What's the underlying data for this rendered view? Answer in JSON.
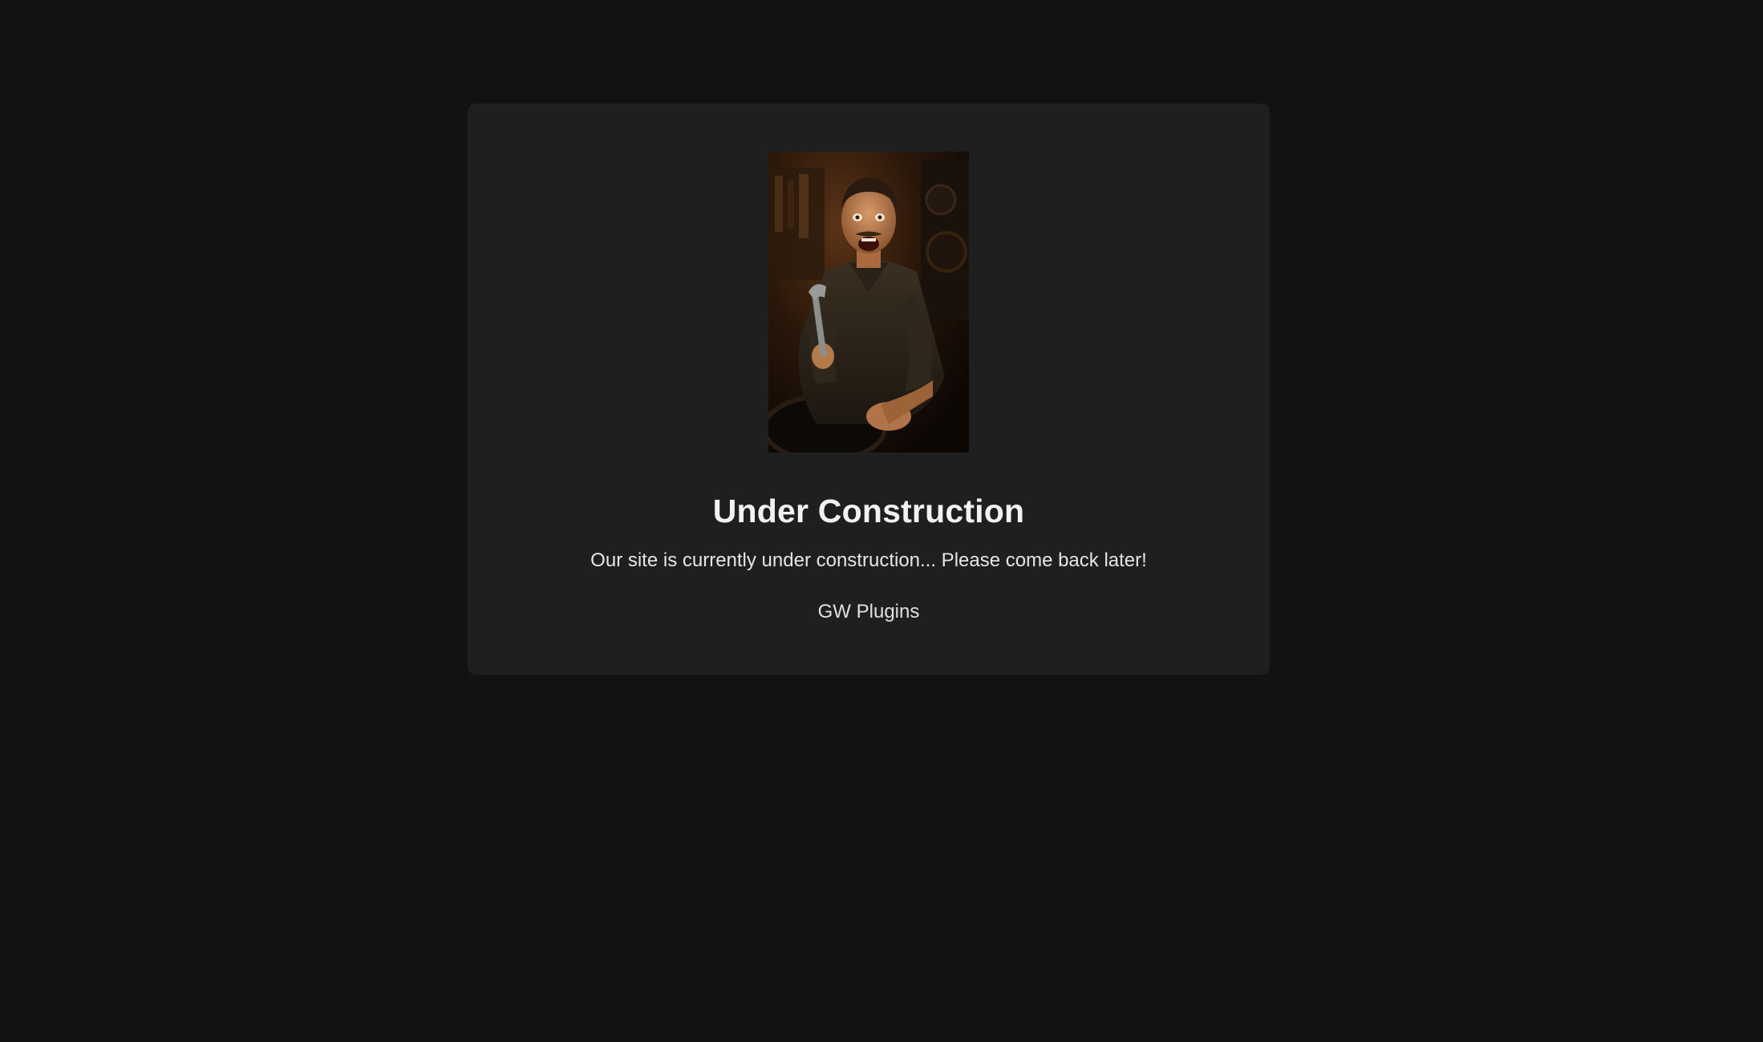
{
  "page": {
    "background_color": "#121212",
    "card_color": "#1f1f1f"
  },
  "hero_image": {
    "alt": "Excited mechanic holding a wrench in a dark garage",
    "icon": "photo-mechanic"
  },
  "title": "Under Construction",
  "message": "Our site is currently under construction... Please come back later!",
  "brand": "GW Plugins"
}
